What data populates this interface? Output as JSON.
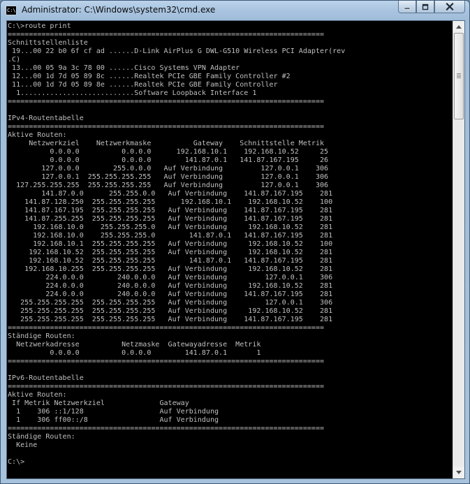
{
  "window": {
    "title": "Administrator: C:\\Windows\\system32\\cmd.exe",
    "icon_label": "C:\\"
  },
  "console": {
    "lines": [
      "C:\\>route print",
      "===========================================================================",
      "Schnittstellenliste",
      " 19...00 22 b0 6f cf ad ......D-Link AirPlus G DWL-G510 Wireless PCI Adapter(rev",
      ".C)",
      " 13...00 05 9a 3c 78 00 ......Cisco Systems VPN Adapter",
      " 12...00 1d 7d 05 89 8c ......Realtek PCIe GBE Family Controller #2",
      " 11...00 1d 7d 05 89 8e ......Realtek PCIe GBE Family Controller",
      "  1...........................Software Loopback Interface 1",
      "===========================================================================",
      "",
      "IPv4-Routentabelle",
      "===========================================================================",
      "Aktive Routen:",
      "     Netzwerkziel    Netzwerkmaske          Gateway    Schnittstelle Metrik",
      "          0.0.0.0          0.0.0.0      192.168.10.1    192.168.10.52     25",
      "          0.0.0.0          0.0.0.0        141.87.0.1   141.87.167.195     26",
      "        127.0.0.0        255.0.0.0   Auf Verbindung         127.0.0.1    306",
      "        127.0.0.1  255.255.255.255   Auf Verbindung         127.0.0.1    306",
      "  127.255.255.255  255.255.255.255   Auf Verbindung         127.0.0.1    306",
      "        141.87.0.0      255.255.0.0   Auf Verbindung    141.87.167.195    281",
      "    141.87.128.250  255.255.255.255      192.168.10.1    192.168.10.52    100",
      "    141.87.167.195  255.255.255.255   Auf Verbindung    141.87.167.195    281",
      "    141.87.255.255  255.255.255.255   Auf Verbindung    141.87.167.195    281",
      "      192.168.10.0    255.255.255.0   Auf Verbindung     192.168.10.52    281",
      "      192.168.10.0    255.255.255.0        141.87.0.1   141.87.167.195    281",
      "      192.168.10.1  255.255.255.255   Auf Verbindung     192.168.10.52    100",
      "     192.168.10.52  255.255.255.255   Auf Verbindung     192.168.10.52    281",
      "     192.168.10.52  255.255.255.255        141.87.0.1   141.87.167.195    281",
      "    192.168.10.255  255.255.255.255   Auf Verbindung     192.168.10.52    281",
      "         224.0.0.0        240.0.0.0   Auf Verbindung         127.0.0.1    306",
      "         224.0.0.0        240.0.0.0   Auf Verbindung     192.168.10.52    281",
      "         224.0.0.0        240.0.0.0   Auf Verbindung    141.87.167.195    281",
      "   255.255.255.255  255.255.255.255   Auf Verbindung         127.0.0.1    306",
      "   255.255.255.255  255.255.255.255   Auf Verbindung     192.168.10.52    281",
      "   255.255.255.255  255.255.255.255   Auf Verbindung    141.87.167.195    281",
      "===========================================================================",
      "Ständige Routen:",
      "  Netzwerkadresse          Netzmaske  Gatewayadresse  Metrik",
      "          0.0.0.0          0.0.0.0        141.87.0.1       1",
      "===========================================================================",
      "",
      "IPv6-Routentabelle",
      "===========================================================================",
      "Aktive Routen:",
      " If Metrik Netzwerkziel             Gateway",
      "  1    306 ::1/128                  Auf Verbindung",
      "  1    306 ff00::/8                 Auf Verbindung",
      "===========================================================================",
      "Ständige Routen:",
      "  Keine",
      "",
      "C:\\>"
    ]
  },
  "icons": {
    "minimize": "minimize-icon",
    "maximize": "maximize-icon",
    "close": "close-icon",
    "scroll_up": "arrow-up-icon",
    "scroll_down": "arrow-down-icon"
  },
  "scrollbar": {
    "thumb_position": 0.0,
    "visible_fraction": 0.2
  },
  "colors": {
    "console_bg": "#000000",
    "console_fg": "#c0c0c0"
  }
}
